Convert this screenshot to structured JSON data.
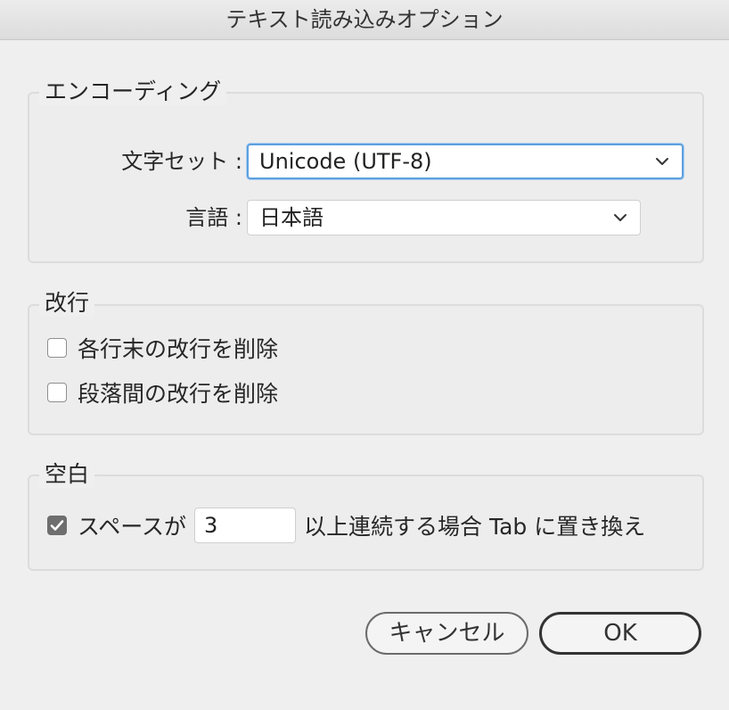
{
  "window": {
    "title": "テキスト読み込みオプション"
  },
  "encoding": {
    "legend": "エンコーディング",
    "charset_label": "文字セット :",
    "charset_value": "Unicode (UTF-8)",
    "language_label": "言語 :",
    "language_value": "日本語"
  },
  "line_breaks": {
    "legend": "改行",
    "remove_line_end": {
      "label": "各行末の改行を削除",
      "checked": false
    },
    "remove_between_paragraphs": {
      "label": "段落間の改行を削除",
      "checked": false
    }
  },
  "spaces": {
    "legend": "空白",
    "replace_prefix": "スペースが",
    "replace_count": "3",
    "replace_suffix": "以上連続する場合 Tab に置き換え",
    "checked": true
  },
  "buttons": {
    "cancel": "キャンセル",
    "ok": "OK"
  },
  "icons": {
    "select_arrow": "chevron-down-icon",
    "check": "checkmark-icon"
  }
}
